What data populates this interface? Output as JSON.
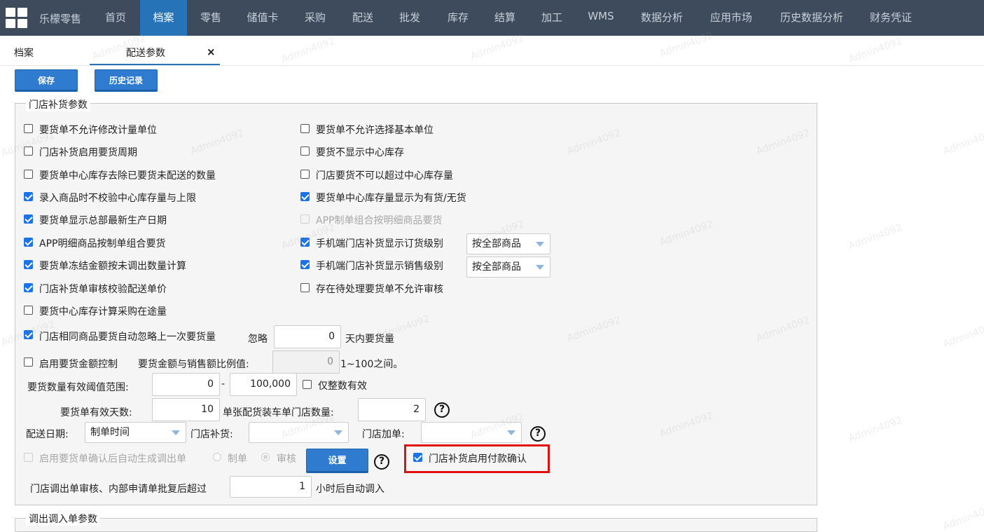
{
  "app": {
    "name": "乐檬零售"
  },
  "nav": {
    "items": [
      {
        "label": "首页"
      },
      {
        "label": "档案"
      },
      {
        "label": "零售"
      },
      {
        "label": "储值卡"
      },
      {
        "label": "采购"
      },
      {
        "label": "配送"
      },
      {
        "label": "批发"
      },
      {
        "label": "库存"
      },
      {
        "label": "结算"
      },
      {
        "label": "加工"
      },
      {
        "label": "WMS"
      },
      {
        "label": "数据分析"
      },
      {
        "label": "应用市场"
      },
      {
        "label": "历史数据分析"
      },
      {
        "label": "财务凭证"
      }
    ],
    "active": "档案"
  },
  "tabs": [
    {
      "label": "档案"
    },
    {
      "label": "配送参数",
      "close": "×"
    }
  ],
  "toolbar": {
    "save_label": "保存",
    "history_label": "历史记录"
  },
  "watermark": "Admin4092",
  "store_replenish": {
    "legend": "门店补货参数",
    "options": [
      {
        "label": "要货单不允许修改计量单位",
        "checked": false
      },
      {
        "label": "要货单不允许选择基本单位",
        "checked": false
      },
      {
        "label": "门店补货启用要货周期",
        "checked": false
      },
      {
        "label": "要货不显示中心库存",
        "checked": false
      },
      {
        "label": "要货单中心库存去除已要货未配送的数量",
        "checked": false
      },
      {
        "label": "门店要货不可以超过中心库存量",
        "checked": false
      },
      {
        "label": "录入商品时不校验中心库存量与上限",
        "checked": true
      },
      {
        "label": "要货单中心库存量显示为有货/无货",
        "checked": true
      },
      {
        "label": "要货单显示总部最新生产日期",
        "checked": true
      },
      {
        "label": "APP制单组合按明细商品要货",
        "checked": false,
        "disabled": true
      },
      {
        "label": "APP明细商品按制单组合要货",
        "checked": true
      },
      {
        "label": "手机端门店补货显示订货级别",
        "checked": true
      },
      {
        "label": "要货单冻结金额按未调出数量计算",
        "checked": true
      },
      {
        "label": "手机端门店补货显示销售级别",
        "checked": true
      },
      {
        "label": "门店补货单审核校验配送单价",
        "checked": true
      },
      {
        "label": "存在待处理要货单不允许审核",
        "checked": false
      },
      {
        "label": "要货中心库存计算采购在途量",
        "checked": false
      }
    ],
    "order_level_select": "按全部商品",
    "sales_level_select": "按全部商品",
    "ignore_row": {
      "label": "门店相同商品要货自动忽略上一次要货量",
      "checked": true,
      "ignore_label": "忽略",
      "days": "0",
      "suffix": "天内要货量"
    },
    "amount_row": {
      "label": "启用要货金额控制",
      "checked": false,
      "ratio_label": "要货金额与销售额比例值:",
      "ratio": "0",
      "range_hint": "1~100之间。"
    },
    "threshold_row": {
      "label": "要货数量有效阈值范围:",
      "min": "0",
      "dash": "-",
      "max": "100,000",
      "integer_label": "仅整数有效",
      "integer_checked": false
    },
    "valid_days_row": {
      "label": "要货单有效天数:",
      "days": "10",
      "truck_label": "单张配货装车单门店数量:",
      "truck_count": "2",
      "help": "?"
    },
    "delivery_row": {
      "date_label": "配送日期:",
      "date_value": "制单时间",
      "replenish_label": "门店补货:",
      "replenish_value": "",
      "add_label": "门店加单:",
      "add_value": "",
      "help": "?"
    },
    "auto_transfer_row": {
      "label": "启用要货单确认后自动生成调出单",
      "checked": false,
      "disabled": true,
      "opt_create": "制单",
      "opt_audit": "审核",
      "selected": "审核",
      "setting_button": "设置",
      "help": "?",
      "payment_label": "门店补货启用付款确认",
      "payment_checked": true
    },
    "auto_in_row": {
      "label": "门店调出单审核、内部申请单批复后超过",
      "hours": "1",
      "suffix": "小时后自动调入"
    }
  },
  "transfer_group": {
    "legend": "调出调入单参数"
  },
  "colors": {
    "nav_bg": "#3d4b5c",
    "accent": "#2673b8",
    "checkbox": "#1a73e8",
    "highlight": "#e01010"
  }
}
